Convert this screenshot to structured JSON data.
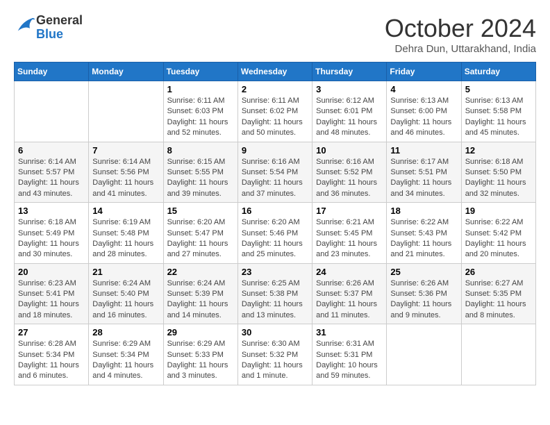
{
  "header": {
    "logo_general": "General",
    "logo_blue": "Blue",
    "month_title": "October 2024",
    "subtitle": "Dehra Dun, Uttarakhand, India"
  },
  "days_of_week": [
    "Sunday",
    "Monday",
    "Tuesday",
    "Wednesday",
    "Thursday",
    "Friday",
    "Saturday"
  ],
  "weeks": [
    [
      {
        "day": "",
        "info": ""
      },
      {
        "day": "",
        "info": ""
      },
      {
        "day": "1",
        "info": "Sunrise: 6:11 AM\nSunset: 6:03 PM\nDaylight: 11 hours and 52 minutes."
      },
      {
        "day": "2",
        "info": "Sunrise: 6:11 AM\nSunset: 6:02 PM\nDaylight: 11 hours and 50 minutes."
      },
      {
        "day": "3",
        "info": "Sunrise: 6:12 AM\nSunset: 6:01 PM\nDaylight: 11 hours and 48 minutes."
      },
      {
        "day": "4",
        "info": "Sunrise: 6:13 AM\nSunset: 6:00 PM\nDaylight: 11 hours and 46 minutes."
      },
      {
        "day": "5",
        "info": "Sunrise: 6:13 AM\nSunset: 5:58 PM\nDaylight: 11 hours and 45 minutes."
      }
    ],
    [
      {
        "day": "6",
        "info": "Sunrise: 6:14 AM\nSunset: 5:57 PM\nDaylight: 11 hours and 43 minutes."
      },
      {
        "day": "7",
        "info": "Sunrise: 6:14 AM\nSunset: 5:56 PM\nDaylight: 11 hours and 41 minutes."
      },
      {
        "day": "8",
        "info": "Sunrise: 6:15 AM\nSunset: 5:55 PM\nDaylight: 11 hours and 39 minutes."
      },
      {
        "day": "9",
        "info": "Sunrise: 6:16 AM\nSunset: 5:54 PM\nDaylight: 11 hours and 37 minutes."
      },
      {
        "day": "10",
        "info": "Sunrise: 6:16 AM\nSunset: 5:52 PM\nDaylight: 11 hours and 36 minutes."
      },
      {
        "day": "11",
        "info": "Sunrise: 6:17 AM\nSunset: 5:51 PM\nDaylight: 11 hours and 34 minutes."
      },
      {
        "day": "12",
        "info": "Sunrise: 6:18 AM\nSunset: 5:50 PM\nDaylight: 11 hours and 32 minutes."
      }
    ],
    [
      {
        "day": "13",
        "info": "Sunrise: 6:18 AM\nSunset: 5:49 PM\nDaylight: 11 hours and 30 minutes."
      },
      {
        "day": "14",
        "info": "Sunrise: 6:19 AM\nSunset: 5:48 PM\nDaylight: 11 hours and 28 minutes."
      },
      {
        "day": "15",
        "info": "Sunrise: 6:20 AM\nSunset: 5:47 PM\nDaylight: 11 hours and 27 minutes."
      },
      {
        "day": "16",
        "info": "Sunrise: 6:20 AM\nSunset: 5:46 PM\nDaylight: 11 hours and 25 minutes."
      },
      {
        "day": "17",
        "info": "Sunrise: 6:21 AM\nSunset: 5:45 PM\nDaylight: 11 hours and 23 minutes."
      },
      {
        "day": "18",
        "info": "Sunrise: 6:22 AM\nSunset: 5:43 PM\nDaylight: 11 hours and 21 minutes."
      },
      {
        "day": "19",
        "info": "Sunrise: 6:22 AM\nSunset: 5:42 PM\nDaylight: 11 hours and 20 minutes."
      }
    ],
    [
      {
        "day": "20",
        "info": "Sunrise: 6:23 AM\nSunset: 5:41 PM\nDaylight: 11 hours and 18 minutes."
      },
      {
        "day": "21",
        "info": "Sunrise: 6:24 AM\nSunset: 5:40 PM\nDaylight: 11 hours and 16 minutes."
      },
      {
        "day": "22",
        "info": "Sunrise: 6:24 AM\nSunset: 5:39 PM\nDaylight: 11 hours and 14 minutes."
      },
      {
        "day": "23",
        "info": "Sunrise: 6:25 AM\nSunset: 5:38 PM\nDaylight: 11 hours and 13 minutes."
      },
      {
        "day": "24",
        "info": "Sunrise: 6:26 AM\nSunset: 5:37 PM\nDaylight: 11 hours and 11 minutes."
      },
      {
        "day": "25",
        "info": "Sunrise: 6:26 AM\nSunset: 5:36 PM\nDaylight: 11 hours and 9 minutes."
      },
      {
        "day": "26",
        "info": "Sunrise: 6:27 AM\nSunset: 5:35 PM\nDaylight: 11 hours and 8 minutes."
      }
    ],
    [
      {
        "day": "27",
        "info": "Sunrise: 6:28 AM\nSunset: 5:34 PM\nDaylight: 11 hours and 6 minutes."
      },
      {
        "day": "28",
        "info": "Sunrise: 6:29 AM\nSunset: 5:34 PM\nDaylight: 11 hours and 4 minutes."
      },
      {
        "day": "29",
        "info": "Sunrise: 6:29 AM\nSunset: 5:33 PM\nDaylight: 11 hours and 3 minutes."
      },
      {
        "day": "30",
        "info": "Sunrise: 6:30 AM\nSunset: 5:32 PM\nDaylight: 11 hours and 1 minute."
      },
      {
        "day": "31",
        "info": "Sunrise: 6:31 AM\nSunset: 5:31 PM\nDaylight: 10 hours and 59 minutes."
      },
      {
        "day": "",
        "info": ""
      },
      {
        "day": "",
        "info": ""
      }
    ]
  ]
}
